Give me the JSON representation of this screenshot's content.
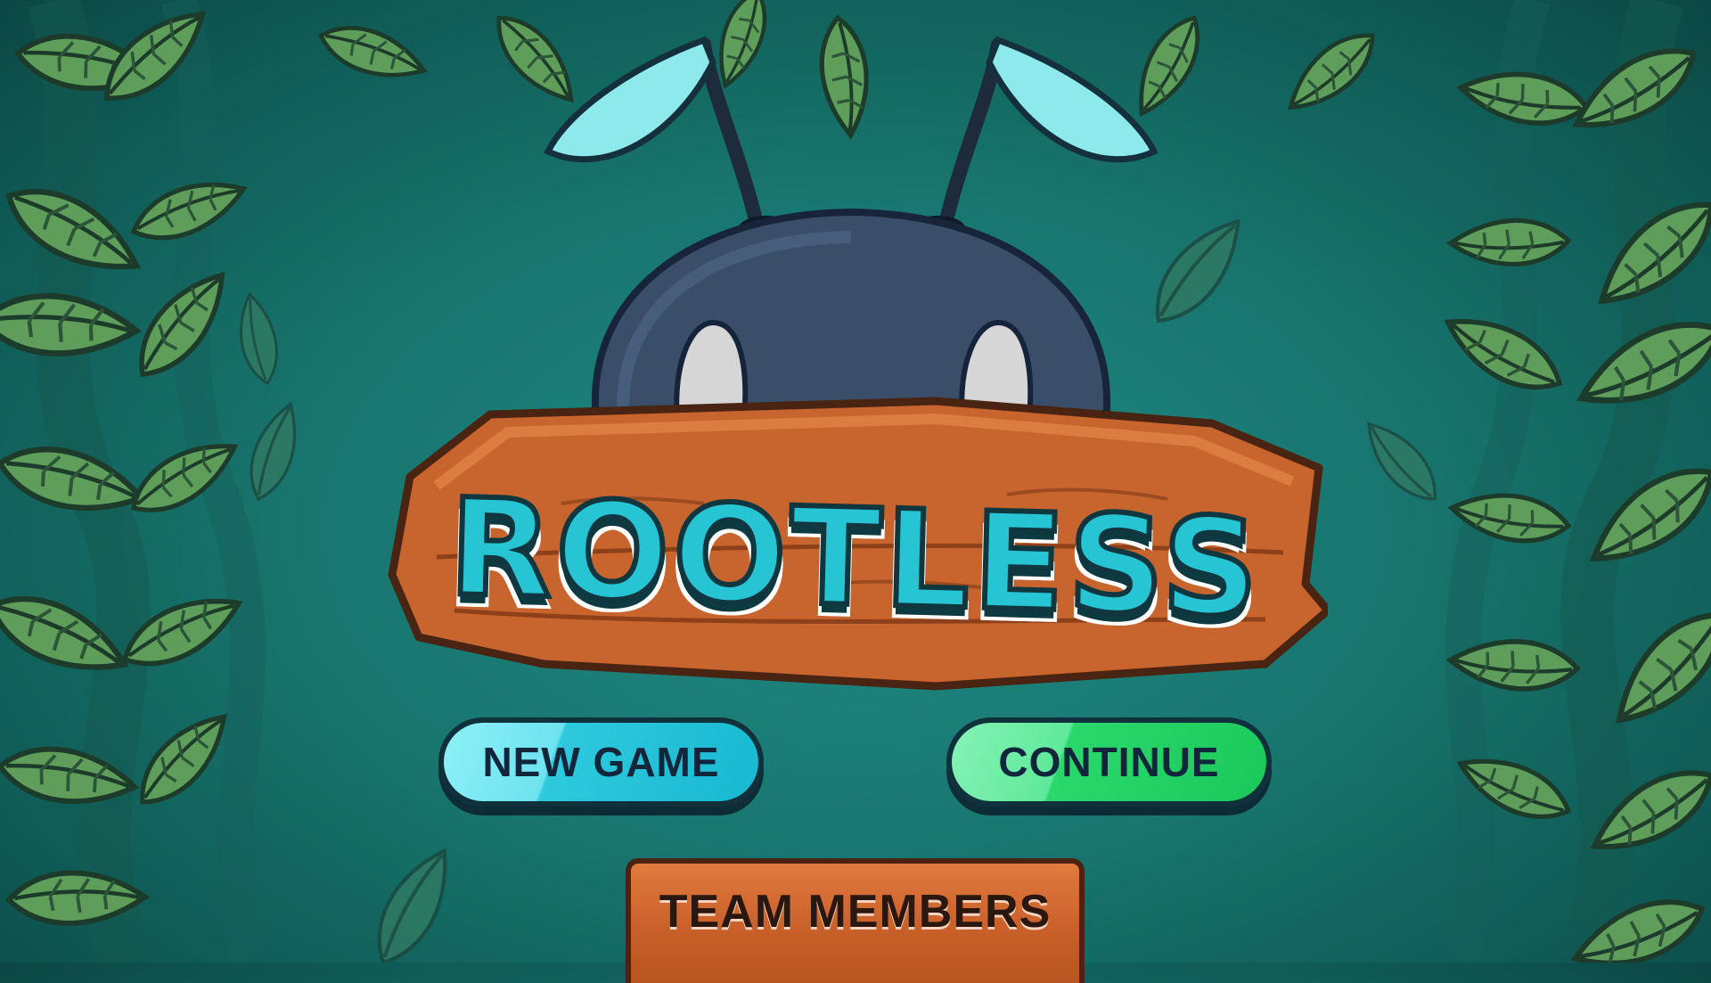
{
  "game": {
    "title": "ROOTLESS",
    "menu": {
      "new_game_label": "NEW GAME",
      "continue_label": "CONTINUE",
      "team_members_label": "TEAM MEMBERS"
    }
  },
  "colors": {
    "background": "#18766f",
    "new_game": "#2ec9dd",
    "continue": "#2ad76b",
    "wood": "#c9602a",
    "title_fill": "#27c4d4",
    "outline": "#10303b"
  },
  "icons": {
    "mascot": "ant-head-icon",
    "foliage": "leaf-icon"
  }
}
